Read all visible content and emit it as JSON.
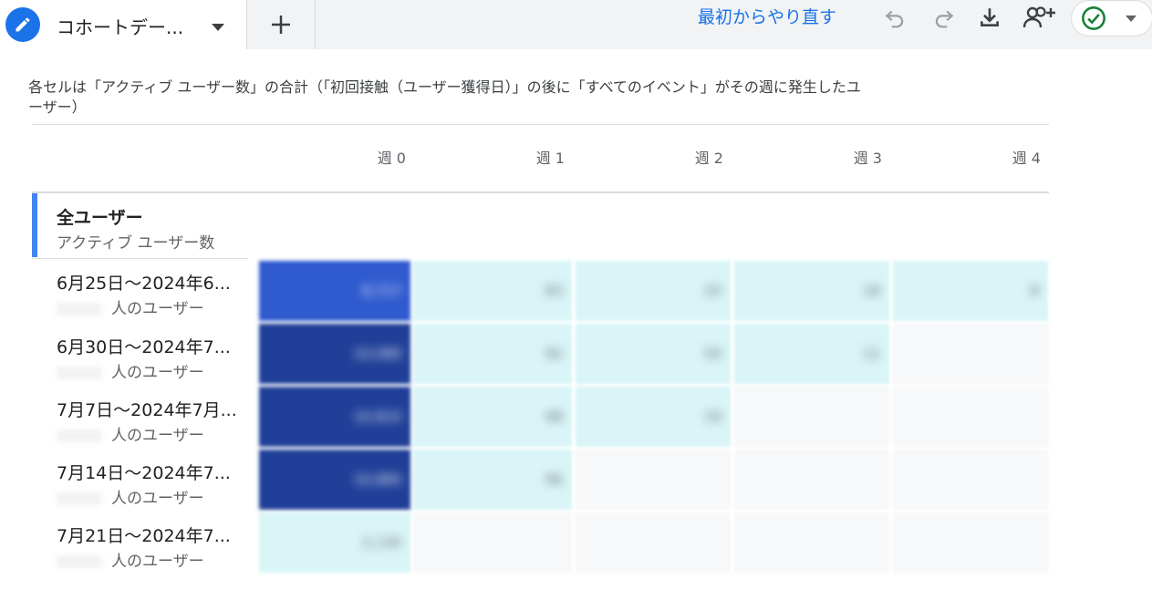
{
  "tab": {
    "label": "コホートデー...",
    "icon": "pencil-icon"
  },
  "toolbar": {
    "restart_label": "最初からやり直す",
    "icons": [
      "undo-icon",
      "redo-icon",
      "download-icon",
      "share-user-icon",
      "check-circle-icon"
    ]
  },
  "description": "各セルは「アクティブ ユーザー数」の合計（「初回接触（ユーザー獲得日）」の後に「すべてのイベント」がその週に発生したユーザー）",
  "weeks": [
    "週 0",
    "週 1",
    "週 2",
    "週 3",
    "週 4"
  ],
  "total": {
    "title": "全ユーザー",
    "metric": "アクティブ ユーザー数"
  },
  "rows": [
    {
      "label": "6月25日～2024年6...",
      "sub": "人のユーザー",
      "cells": [
        "8,717",
        "83",
        "25",
        "18",
        "8"
      ]
    },
    {
      "label": "6月30日～2024年7...",
      "sub": "人のユーザー",
      "cells": [
        "10,089",
        "92",
        "50",
        "11",
        ""
      ]
    },
    {
      "label": "7月7日～2024年7月...",
      "sub": "人のユーザー",
      "cells": [
        "10,810",
        "98",
        "19",
        "",
        ""
      ]
    },
    {
      "label": "7月14日～2024年7...",
      "sub": "人のユーザー",
      "cells": [
        "10,880",
        "96",
        "",
        "",
        ""
      ]
    },
    {
      "label": "7月21日～2024年7...",
      "sub": "人のユーザー",
      "cells": [
        "2,130",
        "",
        "",
        "",
        ""
      ]
    }
  ],
  "colors": {
    "accent": "#1a73e8",
    "cell_dark": "#1f3f98",
    "cell_mid": "#2f5bcf",
    "cell_light": "#d9f5f7",
    "cell_empty": "#f7f8f9"
  }
}
